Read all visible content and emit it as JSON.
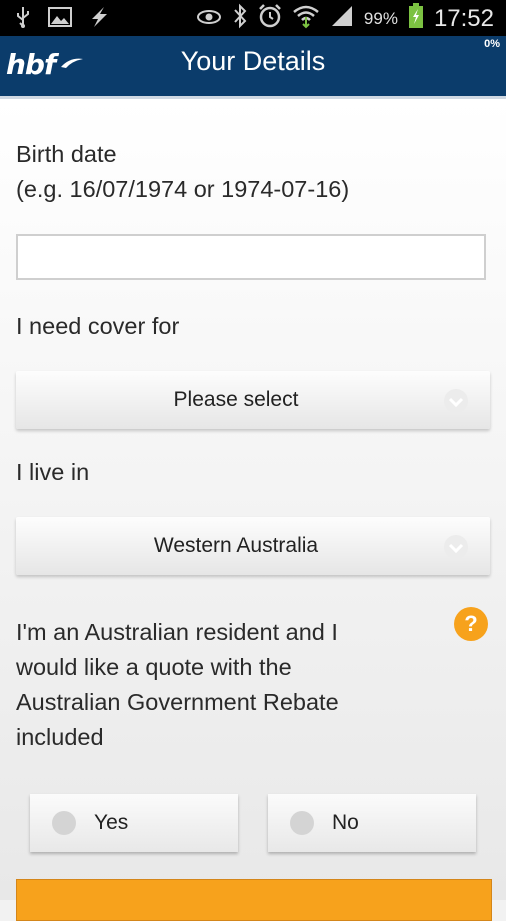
{
  "status_bar": {
    "battery": "99%",
    "time": "17:52"
  },
  "header": {
    "logo_text": "hbf",
    "title": "Your Details",
    "progress": "0%"
  },
  "form": {
    "birth_date_label_line1": "Birth date",
    "birth_date_label_line2": "(e.g. 16/07/1974 or 1974-07-16)",
    "birth_date_value": "",
    "cover_label": "I need cover for",
    "cover_selected": "Please select",
    "state_label": "I live in",
    "state_selected": "Western Australia",
    "rebate_line1": "I'm an Australian resident and I",
    "rebate_line2": "would like a quote with the",
    "rebate_line3": "Australian Government Rebate",
    "rebate_line4": "included",
    "help_symbol": "?",
    "yes_label": "Yes",
    "no_label": "No"
  },
  "colors": {
    "header_bg": "#0b3c6b",
    "accent": "#f7a21c"
  },
  "icons": [
    "usb-icon",
    "image-icon",
    "lightning-icon",
    "eye-icon",
    "bluetooth-icon",
    "alarm-icon",
    "wifi-icon",
    "signal-icon",
    "battery-icon",
    "chevron-down-icon",
    "help-icon"
  ]
}
